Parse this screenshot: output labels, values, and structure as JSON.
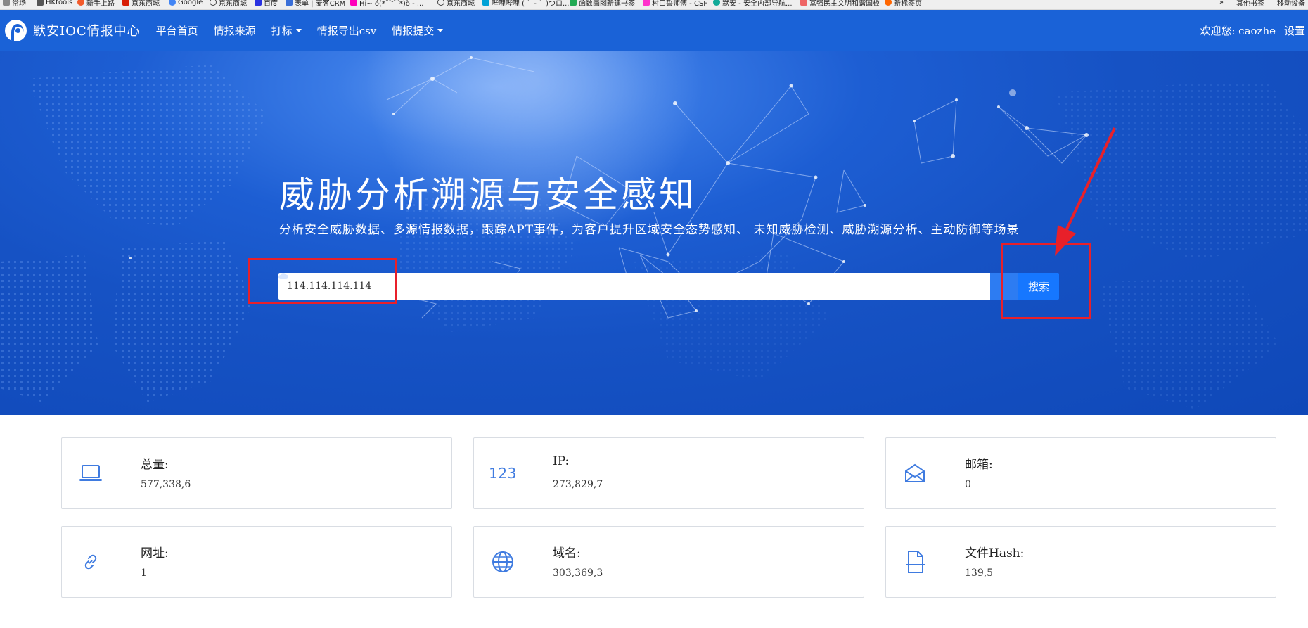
{
  "bookmarks": [
    {
      "label": "常场",
      "color": "#888"
    },
    {
      "label": "HKtools",
      "color": "#555"
    },
    {
      "label": "新手上路",
      "color": "#f25a2a"
    },
    {
      "label": "京东商城",
      "color": "#d81e06"
    },
    {
      "label": "Google",
      "color": "#4285f4"
    },
    {
      "label": "京东商城",
      "color": "#444"
    },
    {
      "label": "百度",
      "color": "#2932e1"
    },
    {
      "label": "表单 | 麦客CRM",
      "color": "#3a6fd8"
    },
    {
      "label": "Hi~ ó(*ˇ﹀ˇ*)ò - ...",
      "color": "#f0b"
    },
    {
      "label": "京东商城",
      "color": "#444"
    },
    {
      "label": "哔哩哔哩 ( ゜- ゜)つロ...",
      "color": "#00a1d6"
    },
    {
      "label": "函数画图新建书签",
      "color": "#22aa55"
    },
    {
      "label": "村口誓师傅 - CSF",
      "color": "#f3c"
    },
    {
      "label": "默安 - 安全内部导航...",
      "color": "#1a9"
    },
    {
      "label": "富强民主文明和谐国板",
      "color": "#e66"
    },
    {
      "label": "新标签页",
      "color": "#f60"
    }
  ],
  "bookmarks_right": [
    "其他书签",
    "移动设备"
  ],
  "nav": {
    "brand": "默安IOC情报中心",
    "items": [
      {
        "label": "平台首页",
        "dropdown": false
      },
      {
        "label": "情报来源",
        "dropdown": false
      },
      {
        "label": "打标",
        "dropdown": true
      },
      {
        "label": "情报导出csv",
        "dropdown": false
      },
      {
        "label": "情报提交",
        "dropdown": true
      }
    ],
    "welcome": "欢迎您: caozhe",
    "settings": "设置"
  },
  "hero": {
    "title": "威胁分析溯源与安全感知",
    "subtitle": "分析安全威胁数据、多源情报数据，跟踪APT事件，为客户提升区域安全态势感知、 未知威胁检测、威胁溯源分析、主动防御等场景",
    "search_value": "114.114.114.114",
    "search_button": "搜索"
  },
  "stats": [
    {
      "icon": "laptop-icon",
      "label": "总量:",
      "value": "577,338,6"
    },
    {
      "icon": "number-123-icon",
      "icon_text": "123",
      "label": "IP:",
      "value": "273,829,7"
    },
    {
      "icon": "envelope-icon",
      "label": "邮箱:",
      "value": "0"
    },
    {
      "icon": "link-icon",
      "label": "网址:",
      "value": "1"
    },
    {
      "icon": "globe-icon",
      "label": "域名:",
      "value": "303,369,3"
    },
    {
      "icon": "file-icon",
      "label": "文件Hash:",
      "value": "139,5"
    }
  ],
  "colors": {
    "navbar": "#1a62d7",
    "hero": "#1652c4",
    "button": "#1677ff",
    "annotation": "#e8202a",
    "icon": "#3f7be0"
  }
}
